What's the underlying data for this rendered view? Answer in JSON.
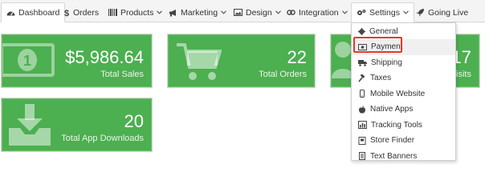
{
  "nav": {
    "tabs": [
      {
        "label": "Dashboard",
        "icon": "dashboard-icon",
        "active": true
      },
      {
        "label": "Orders",
        "icon": "dollar-icon"
      },
      {
        "label": "Products",
        "icon": "barcode-icon",
        "has_dropdown": true
      },
      {
        "label": "Marketing",
        "icon": "megaphone-icon",
        "has_dropdown": true
      },
      {
        "label": "Design",
        "icon": "image-icon",
        "has_dropdown": true
      },
      {
        "label": "Integration",
        "icon": "link-icon",
        "has_dropdown": true
      },
      {
        "label": "Settings",
        "icon": "gears-icon",
        "has_dropdown": true,
        "open": true
      },
      {
        "label": "Going Live",
        "icon": "rocket-icon"
      }
    ]
  },
  "tiles": {
    "sales": {
      "value": "$5,986.64",
      "label": "Total Sales",
      "icon": "money-icon"
    },
    "orders": {
      "value": "22",
      "label": "Total Orders",
      "icon": "cart-icon"
    },
    "visits": {
      "value": "17",
      "label": "Visits",
      "icon": "users-icon"
    },
    "downloads": {
      "value": "20",
      "label": "Total App Downloads",
      "icon": "download-icon"
    }
  },
  "settings_menu": {
    "items": [
      {
        "label": "General",
        "icon": "gear-icon"
      },
      {
        "label": "Payment",
        "icon": "payment-icon",
        "highlighted": true
      },
      {
        "label": "Shipping",
        "icon": "truck-icon"
      },
      {
        "label": "Taxes",
        "icon": "gavel-icon"
      },
      {
        "label": "Mobile Website",
        "icon": "mobile-icon"
      },
      {
        "label": "Native Apps",
        "icon": "apple-icon"
      },
      {
        "label": "Tracking Tools",
        "icon": "bar-chart-icon"
      },
      {
        "label": "Store Finder",
        "icon": "store-icon"
      },
      {
        "label": "Text Banners",
        "icon": "document-icon"
      }
    ]
  },
  "colors": {
    "tile_green": "#4caf50",
    "highlight_red": "#e53a2b",
    "nav_bg": "#f4f4f4"
  }
}
